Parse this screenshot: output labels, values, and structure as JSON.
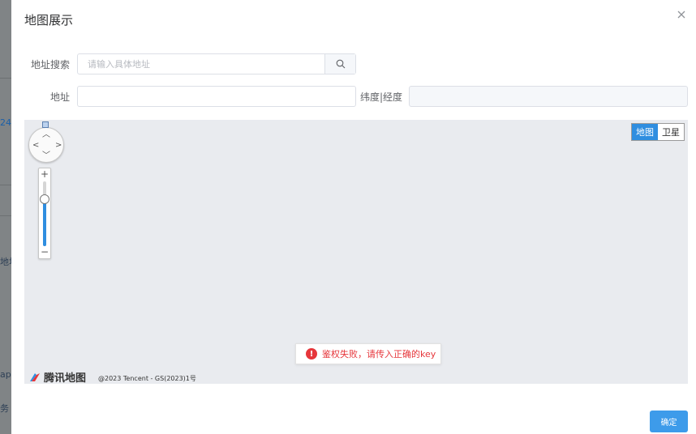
{
  "dialog": {
    "title": "地图展示"
  },
  "form": {
    "search_label": "地址搜索",
    "search_placeholder": "请输入具体地址",
    "address_label": "地址",
    "coords_label": "纬度|经度",
    "address_value": "",
    "coords_value": ""
  },
  "map": {
    "type_tabs": [
      {
        "label": "地图",
        "active": true
      },
      {
        "label": "卫星",
        "active": false
      }
    ],
    "zoom": {
      "plus": "+",
      "minus": "−",
      "level_fraction": 0.72
    },
    "error_message": "鉴权失败，请传入正确的key",
    "brand": "腾讯地图",
    "copyright": "@2023 Tencent - GS(2023)1号"
  },
  "footer": {
    "confirm_label": "确定"
  },
  "background": {
    "fragments": [
      "24",
      "地址",
      "ap",
      "务"
    ]
  },
  "colors": {
    "accent": "#3d9bea",
    "error": "#e6363b",
    "map_bg": "#e9ebef"
  },
  "icons": [
    "close-icon",
    "search-icon",
    "error-icon",
    "tencent-map-logo-icon",
    "pan-arrow-icons"
  ]
}
